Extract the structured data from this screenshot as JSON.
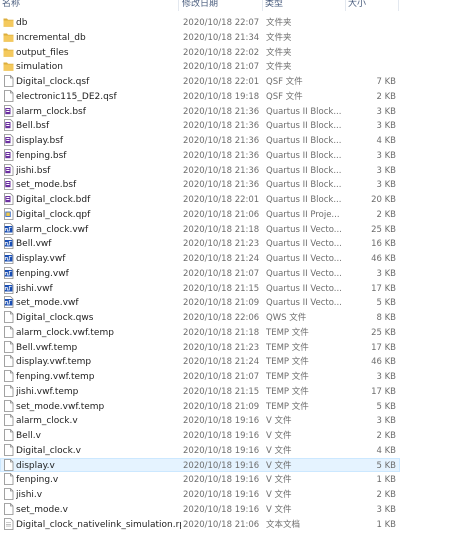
{
  "columns": {
    "name": "名称",
    "date": "修改日期",
    "type": "类型",
    "size": "大小"
  },
  "files": [
    {
      "name": "db",
      "date": "2020/10/18 22:07",
      "type": "文件夹",
      "size": "",
      "icon": "folder-icon"
    },
    {
      "name": "incremental_db",
      "date": "2020/10/18 21:34",
      "type": "文件夹",
      "size": "",
      "icon": "folder-icon"
    },
    {
      "name": "output_files",
      "date": "2020/10/18 22:02",
      "type": "文件夹",
      "size": "",
      "icon": "folder-icon"
    },
    {
      "name": "simulation",
      "date": "2020/10/18 21:07",
      "type": "文件夹",
      "size": "",
      "icon": "folder-icon"
    },
    {
      "name": "Digital_clock.qsf",
      "date": "2020/10/18 22:01",
      "type": "QSF 文件",
      "size": "7 KB",
      "icon": "document-icon"
    },
    {
      "name": "electronic115_DE2.qsf",
      "date": "2020/10/18 19:18",
      "type": "QSF 文件",
      "size": "2 KB",
      "icon": "document-icon"
    },
    {
      "name": "alarm_clock.bsf",
      "date": "2020/10/18 21:36",
      "type": "Quartus II Block...",
      "size": "3 KB",
      "icon": "block-file-icon"
    },
    {
      "name": "Bell.bsf",
      "date": "2020/10/18 21:36",
      "type": "Quartus II Block...",
      "size": "3 KB",
      "icon": "block-file-icon"
    },
    {
      "name": "display.bsf",
      "date": "2020/10/18 21:36",
      "type": "Quartus II Block...",
      "size": "4 KB",
      "icon": "block-file-icon"
    },
    {
      "name": "fenping.bsf",
      "date": "2020/10/18 21:36",
      "type": "Quartus II Block...",
      "size": "3 KB",
      "icon": "block-file-icon"
    },
    {
      "name": "jishi.bsf",
      "date": "2020/10/18 21:36",
      "type": "Quartus II Block...",
      "size": "3 KB",
      "icon": "block-file-icon"
    },
    {
      "name": "set_mode.bsf",
      "date": "2020/10/18 21:36",
      "type": "Quartus II Block...",
      "size": "3 KB",
      "icon": "block-file-icon"
    },
    {
      "name": "Digital_clock.bdf",
      "date": "2020/10/18 22:01",
      "type": "Quartus II Block...",
      "size": "20 KB",
      "icon": "block-file-icon"
    },
    {
      "name": "Digital_clock.qpf",
      "date": "2020/10/18 21:06",
      "type": "Quartus II Proje...",
      "size": "2 KB",
      "icon": "project-file-icon"
    },
    {
      "name": "alarm_clock.vwf",
      "date": "2020/10/18 21:18",
      "type": "Quartus II Vecto...",
      "size": "25 KB",
      "icon": "waveform-file-icon"
    },
    {
      "name": "Bell.vwf",
      "date": "2020/10/18 21:23",
      "type": "Quartus II Vecto...",
      "size": "16 KB",
      "icon": "waveform-file-icon"
    },
    {
      "name": "display.vwf",
      "date": "2020/10/18 21:24",
      "type": "Quartus II Vecto...",
      "size": "46 KB",
      "icon": "waveform-file-icon"
    },
    {
      "name": "fenping.vwf",
      "date": "2020/10/18 21:07",
      "type": "Quartus II Vecto...",
      "size": "3 KB",
      "icon": "waveform-file-icon"
    },
    {
      "name": "jishi.vwf",
      "date": "2020/10/18 21:15",
      "type": "Quartus II Vecto...",
      "size": "17 KB",
      "icon": "waveform-file-icon"
    },
    {
      "name": "set_mode.vwf",
      "date": "2020/10/18 21:09",
      "type": "Quartus II Vecto...",
      "size": "5 KB",
      "icon": "waveform-file-icon"
    },
    {
      "name": "Digital_clock.qws",
      "date": "2020/10/18 22:06",
      "type": "QWS 文件",
      "size": "8 KB",
      "icon": "document-icon"
    },
    {
      "name": "alarm_clock.vwf.temp",
      "date": "2020/10/18 21:18",
      "type": "TEMP 文件",
      "size": "25 KB",
      "icon": "document-icon"
    },
    {
      "name": "Bell.vwf.temp",
      "date": "2020/10/18 21:23",
      "type": "TEMP 文件",
      "size": "17 KB",
      "icon": "document-icon"
    },
    {
      "name": "display.vwf.temp",
      "date": "2020/10/18 21:24",
      "type": "TEMP 文件",
      "size": "46 KB",
      "icon": "document-icon"
    },
    {
      "name": "fenping.vwf.temp",
      "date": "2020/10/18 21:07",
      "type": "TEMP 文件",
      "size": "3 KB",
      "icon": "document-icon"
    },
    {
      "name": "jishi.vwf.temp",
      "date": "2020/10/18 21:15",
      "type": "TEMP 文件",
      "size": "17 KB",
      "icon": "document-icon"
    },
    {
      "name": "set_mode.vwf.temp",
      "date": "2020/10/18 21:09",
      "type": "TEMP 文件",
      "size": "5 KB",
      "icon": "document-icon"
    },
    {
      "name": "alarm_clock.v",
      "date": "2020/10/18 19:16",
      "type": "V 文件",
      "size": "3 KB",
      "icon": "document-icon"
    },
    {
      "name": "Bell.v",
      "date": "2020/10/18 19:16",
      "type": "V 文件",
      "size": "2 KB",
      "icon": "document-icon"
    },
    {
      "name": "Digital_clock.v",
      "date": "2020/10/18 19:16",
      "type": "V 文件",
      "size": "4 KB",
      "icon": "document-icon"
    },
    {
      "name": "display.v",
      "date": "2020/10/18 19:16",
      "type": "V 文件",
      "size": "5 KB",
      "icon": "document-icon",
      "selected": true
    },
    {
      "name": "fenping.v",
      "date": "2020/10/18 19:16",
      "type": "V 文件",
      "size": "1 KB",
      "icon": "document-icon"
    },
    {
      "name": "jishi.v",
      "date": "2020/10/18 19:16",
      "type": "V 文件",
      "size": "2 KB",
      "icon": "document-icon"
    },
    {
      "name": "set_mode.v",
      "date": "2020/10/18 19:16",
      "type": "V 文件",
      "size": "3 KB",
      "icon": "document-icon"
    },
    {
      "name": "Digital_clock_nativelink_simulation.rpt",
      "date": "2020/10/18 21:06",
      "type": "文本文档",
      "size": "1 KB",
      "icon": "text-document-icon"
    }
  ],
  "colors": {
    "selection_bg": "#e5f3ff",
    "selection_border": "#cce8ff",
    "folder": "#f4c95d",
    "folder_dark": "#dcae3c",
    "block_purple": "#6b2fa0",
    "wave_blue": "#1a4fb5"
  }
}
